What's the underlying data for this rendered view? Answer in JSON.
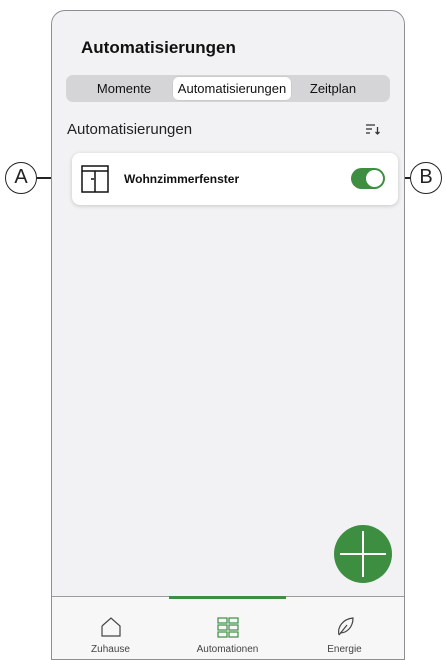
{
  "page": {
    "title": "Automatisierungen"
  },
  "segments": {
    "items": [
      {
        "label": "Momente"
      },
      {
        "label": "Automatisierungen"
      },
      {
        "label": "Zeitplan"
      }
    ],
    "active_index": 1
  },
  "section": {
    "title": "Automatisierungen",
    "sort_icon": "sort-icon"
  },
  "automation": {
    "name": "Wohnzimmerfenster",
    "icon": "window-icon",
    "enabled": true
  },
  "fab": {
    "icon": "plus-icon"
  },
  "tabs": [
    {
      "label": "Zuhause",
      "icon": "home-icon"
    },
    {
      "label": "Automationen",
      "icon": "grid-icon"
    },
    {
      "label": "Energie",
      "icon": "leaf-icon"
    }
  ],
  "active_tab_index": 1,
  "callouts": {
    "a": "A",
    "b": "B"
  },
  "colors": {
    "accent": "#3e8e41",
    "background": "#f2f2f4"
  }
}
